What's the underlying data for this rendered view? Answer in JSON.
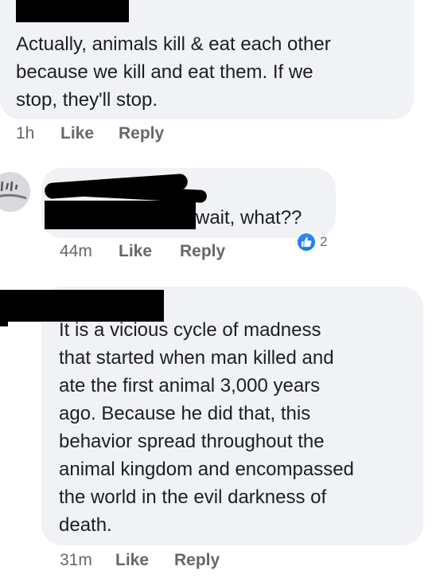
{
  "comments": [
    {
      "text": "Actually, animals kill & eat each other because we kill and eat them. If we stop, they'll stop.",
      "line1": "Actually, animals kill & eat each other",
      "line2": "because we kill and eat them. If we",
      "line3": "stop, they'll stop.",
      "time": "1h",
      "like_label": "Like",
      "reply_label": "Reply"
    },
    {
      "text": "wait, what??",
      "time": "44m",
      "like_label": "Like",
      "reply_label": "Reply",
      "reaction_icon": "like-icon",
      "reaction_count": "2"
    },
    {
      "line1": "It is a vicious cycle of madness",
      "line2": "that started when man killed and",
      "line3": "ate the first animal 3,000 years",
      "line4": "ago. Because he did that, this",
      "line5": "behavior spread throughout the",
      "line6": "animal kingdom and encompassed",
      "line7": "the world in the evil darkness of",
      "line8": "death.",
      "time": "31m",
      "like_label": "Like",
      "reply_label": "Reply"
    }
  ],
  "colors": {
    "bubble": "#f0f2f5",
    "meta_text": "#65676b",
    "reaction_blue": "#1877f2"
  }
}
